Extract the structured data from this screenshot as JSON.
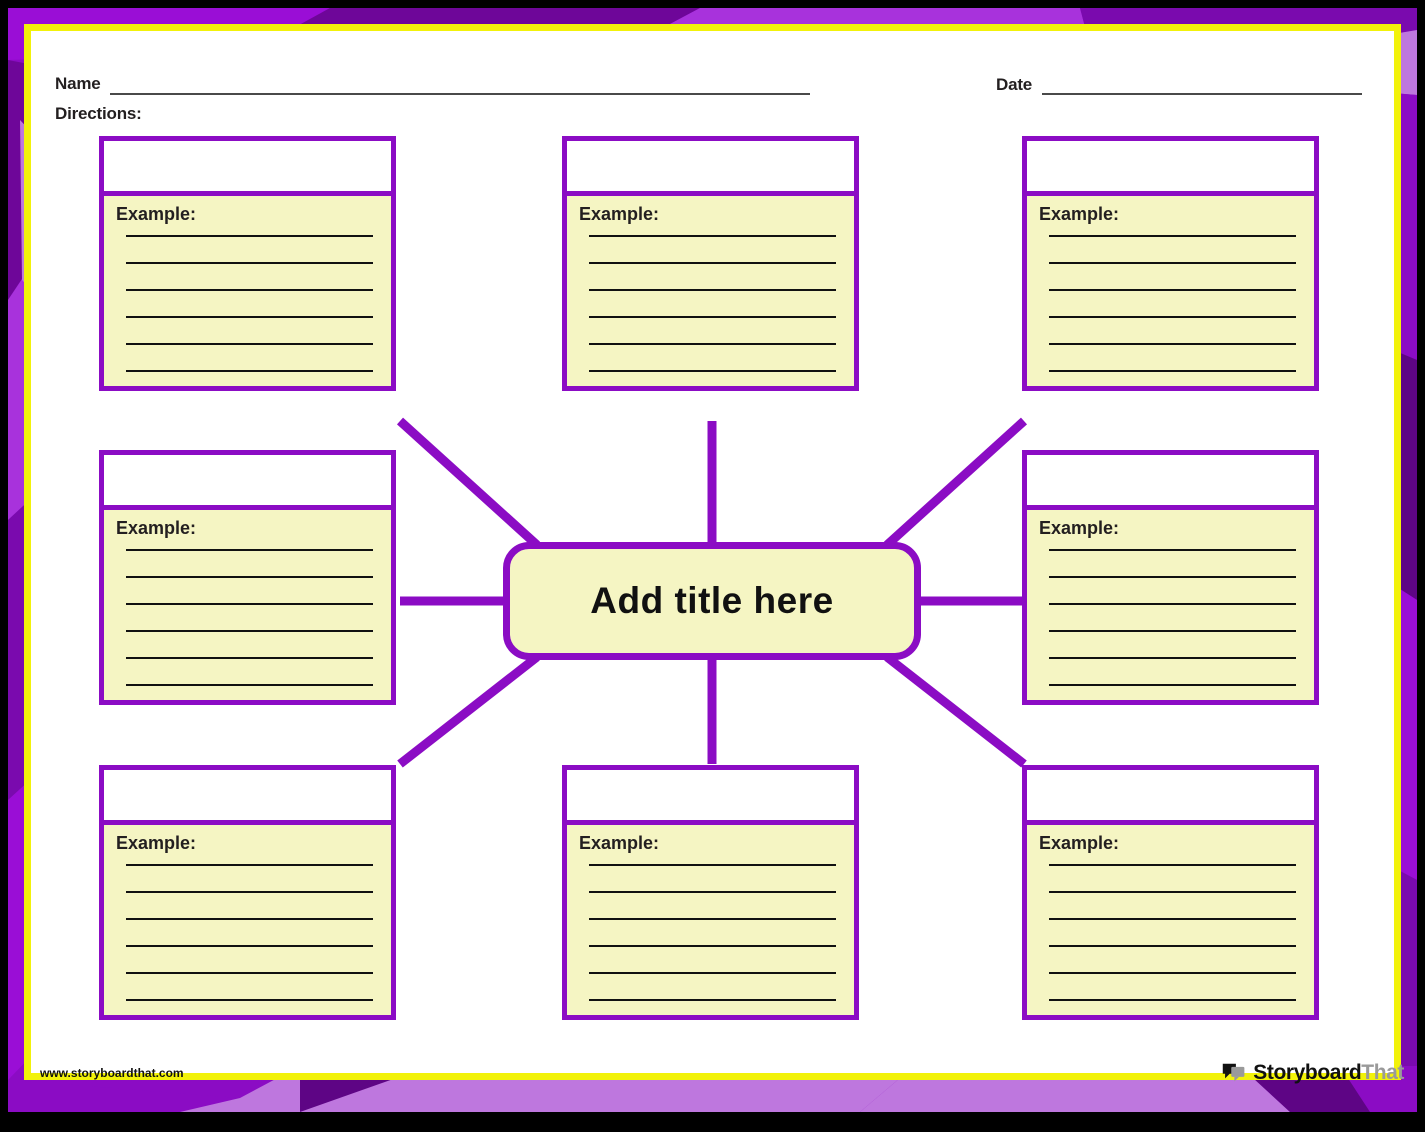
{
  "page": {
    "background_color": "#ffffff",
    "accent_purple": "#8B0CC4",
    "accent_yellow_frame": "#F2F20A",
    "card_fill": "#F5F5C3"
  },
  "header": {
    "name_label": "Name",
    "date_label": "Date",
    "directions_label": "Directions:",
    "name_value": "",
    "date_value": "",
    "directions_value": ""
  },
  "center": {
    "title": "Add title here"
  },
  "cards": [
    {
      "id": "top-left",
      "title": "",
      "example_label": "Example:",
      "lines": 6
    },
    {
      "id": "top-center",
      "title": "",
      "example_label": "Example:",
      "lines": 6
    },
    {
      "id": "top-right",
      "title": "",
      "example_label": "Example:",
      "lines": 6
    },
    {
      "id": "middle-left",
      "title": "",
      "example_label": "Example:",
      "lines": 6
    },
    {
      "id": "middle-right",
      "title": "",
      "example_label": "Example:",
      "lines": 6
    },
    {
      "id": "bottom-left",
      "title": "",
      "example_label": "Example:",
      "lines": 6
    },
    {
      "id": "bottom-center",
      "title": "",
      "example_label": "Example:",
      "lines": 6
    },
    {
      "id": "bottom-right",
      "title": "",
      "example_label": "Example:",
      "lines": 6
    }
  ],
  "footer": {
    "site_url": "www.storyboardthat.com",
    "logo_primary": "Storyboard",
    "logo_secondary": "That",
    "logo_icon": "speech-bubbles-icon"
  }
}
